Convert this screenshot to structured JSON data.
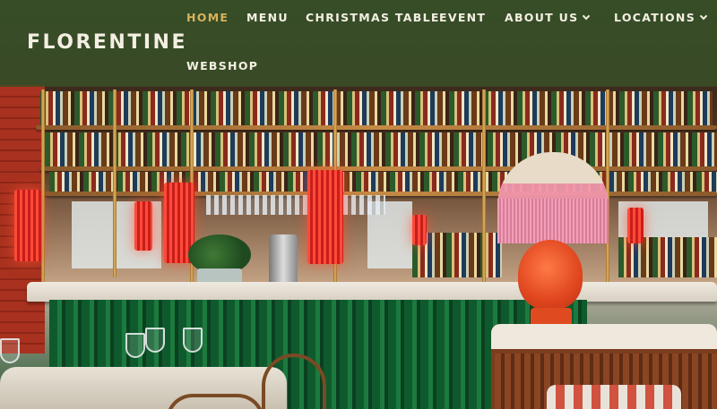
{
  "brand": {
    "logo_text": "FLORENTINE"
  },
  "nav": {
    "items": [
      {
        "label": "HOME",
        "active": true
      },
      {
        "label": "MENU"
      },
      {
        "label": "CHRISTMAS TABLE"
      },
      {
        "label": "EVENT"
      },
      {
        "label": "ABOUT US",
        "icon": "chevron-down-icon"
      },
      {
        "label": "LOCATIONS",
        "icon": "chevron-down-icon"
      },
      {
        "label": "WEBSHOP"
      }
    ]
  },
  "colors": {
    "nav_background": "#395326",
    "nav_text": "#f4efe2",
    "active_text": "#d9b25a"
  }
}
